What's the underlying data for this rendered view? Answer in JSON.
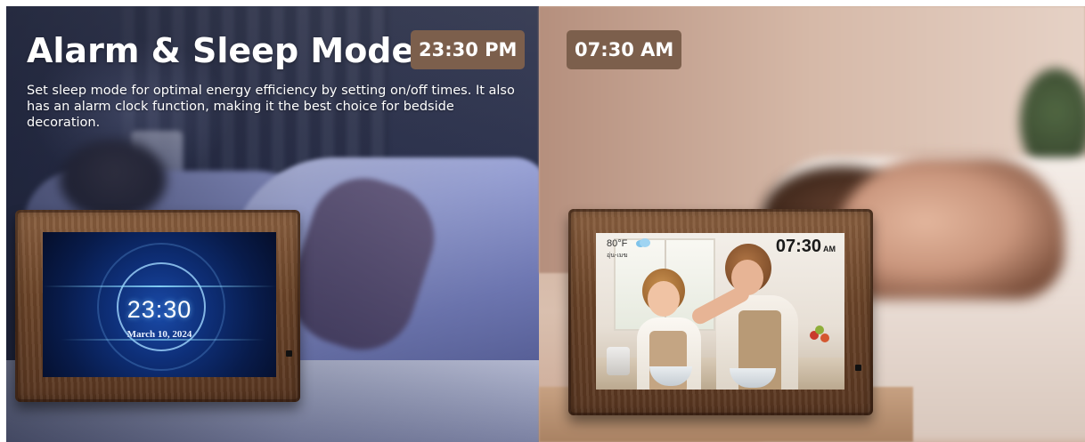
{
  "headline": {
    "title": "Alarm & Sleep Mode",
    "description": "Set sleep mode for optimal energy efficiency by setting on/off times. It also has an alarm clock function, making it the best choice for bedside decoration."
  },
  "badges": {
    "sleep_time": "23:30 PM",
    "wake_time": "07:30 AM"
  },
  "night_frame": {
    "clock_time": "23:30",
    "clock_date": "March 10, 2024"
  },
  "day_frame": {
    "temperature": "80°F",
    "weather_subtext": "อุ่น-เมฆ",
    "time": "07:30",
    "ampm": "AM",
    "weather_icon": "cloud-icon"
  },
  "colors": {
    "badge_bg": "#7c5f4c",
    "wood": "#6b4428",
    "text": "#ffffff"
  }
}
